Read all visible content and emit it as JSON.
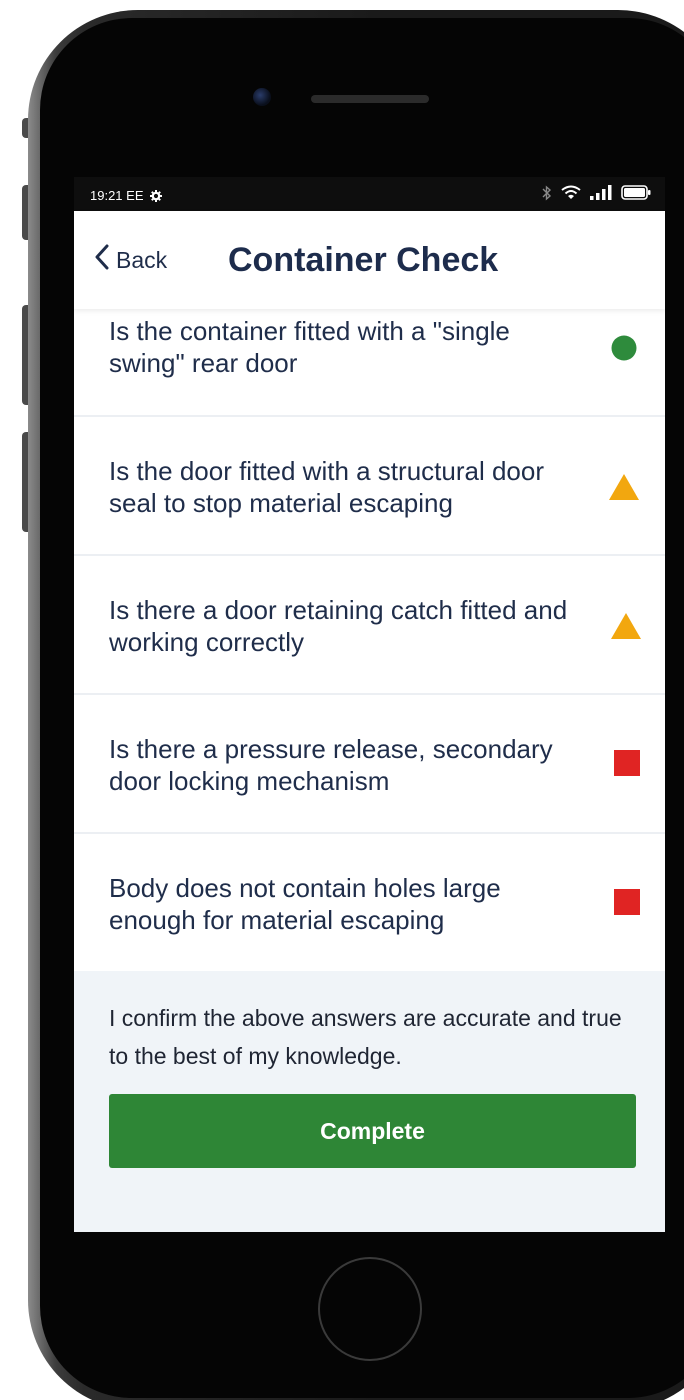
{
  "status_bar": {
    "time": "19:21",
    "carrier": "EE",
    "settings_icon": "gear-icon",
    "bluetooth_icon": "bluetooth-icon",
    "wifi_icon": "wifi-icon",
    "signal_icon": "signal-icon",
    "battery_icon": "battery-icon"
  },
  "header": {
    "back_label": "Back",
    "title": "Container Check"
  },
  "questions": [
    {
      "text": "Is the container fitted with a \"single swing\" rear door",
      "status": "green-circle"
    },
    {
      "text": "Is the door fitted with a structural door seal to stop material escaping",
      "status": "amber-triangle"
    },
    {
      "text": "Is there a door retaining catch fitted and working correctly",
      "status": "amber-triangle"
    },
    {
      "text": "Is there a pressure release, secondary door locking mechanism",
      "status": "red-square"
    },
    {
      "text": "Body does not contain holes large enough for material escaping",
      "status": "red-square"
    }
  ],
  "confirmation": {
    "text": "I confirm the above answers are accurate and true to the best of my knowledge.",
    "button_label": "Complete"
  },
  "colors": {
    "status_green": "#2e8b3c",
    "status_amber": "#f2a70f",
    "status_red": "#e02423",
    "button_green": "#2e8636",
    "text_navy": "#1d2c4c"
  }
}
